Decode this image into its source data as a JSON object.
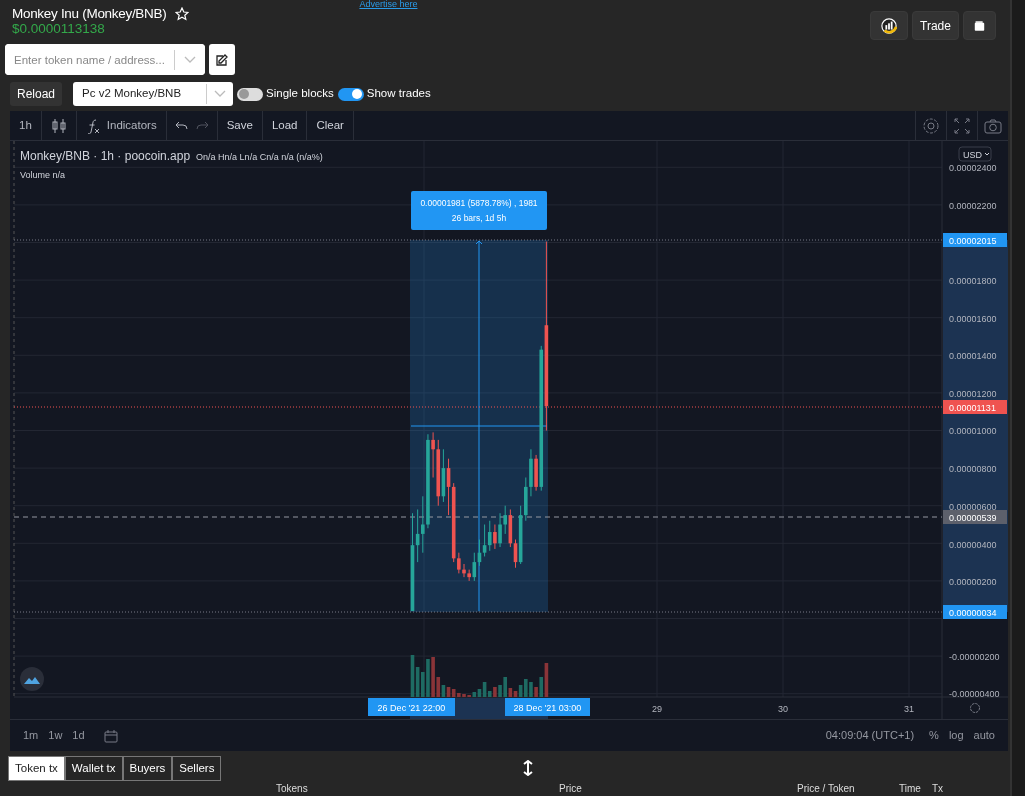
{
  "header": {
    "advertise": "Advertise here",
    "title": "Monkey Inu (Monkey/BNB)",
    "price": "$0.0000113138"
  },
  "header_buttons": [
    {
      "kind": "chart-logo"
    },
    {
      "kind": "text",
      "label": "Trade"
    },
    {
      "kind": "wallet"
    }
  ],
  "token_search": {
    "placeholder": "Enter token name / address..."
  },
  "controls": {
    "reload": "Reload",
    "pair_select": "Pc v2 Monkey/BNB",
    "toggles": [
      {
        "label": "Single blocks",
        "on": false
      },
      {
        "label": "Show trades",
        "on": true
      }
    ]
  },
  "chart_toolbar": {
    "interval": "1h",
    "indicators": "Indicators",
    "actions": [
      "Save",
      "Load",
      "Clear"
    ]
  },
  "chart": {
    "legend_title": "Monkey/BNB · 1h · poocoin.app",
    "ohlc": "On/a Hn/a Ln/a Cn/a n/a (n/a%)",
    "volume": "Volume n/a",
    "currency": "USD",
    "tooltip": [
      "0.00001981 (5878.78%) , 1981",
      "26 bars, 1d 5h"
    ],
    "price_ticks": [
      "0.00002400",
      "0.00002200",
      "0.00001800",
      "0.00001600",
      "0.00001400",
      "0.00001200",
      "0.00001000",
      "0.00000800",
      "0.00000600",
      "0.00000400",
      "0.00000200",
      "-0.00000200",
      "-0.00000400"
    ],
    "price_tags": [
      {
        "label": "0.00002015",
        "kind": "range"
      },
      {
        "label": "0.00001131",
        "kind": "last"
      },
      {
        "label": "0.00000539",
        "kind": "previous"
      },
      {
        "label": "0.00000034",
        "kind": "range"
      }
    ],
    "time_tags": [
      "26 Dec '21   22:00",
      "28 Dec '21   03:00"
    ],
    "time_ticks": [
      "29",
      "30",
      "31"
    ]
  },
  "bottom_bar": {
    "ranges": [
      "1m",
      "1w",
      "1d"
    ],
    "clock": "04:09:04 (UTC+1)",
    "scale_options": [
      "%",
      "log",
      "auto"
    ]
  },
  "tx_tabs": [
    {
      "label": "Token tx",
      "selected": true
    },
    {
      "label": "Wallet tx",
      "selected": false
    },
    {
      "label": "Buyers",
      "selected": false
    },
    {
      "label": "Sellers",
      "selected": false
    }
  ],
  "table": {
    "columns": [
      "Tokens",
      "Price",
      "Price / Token",
      "Time",
      "Tx"
    ]
  }
}
